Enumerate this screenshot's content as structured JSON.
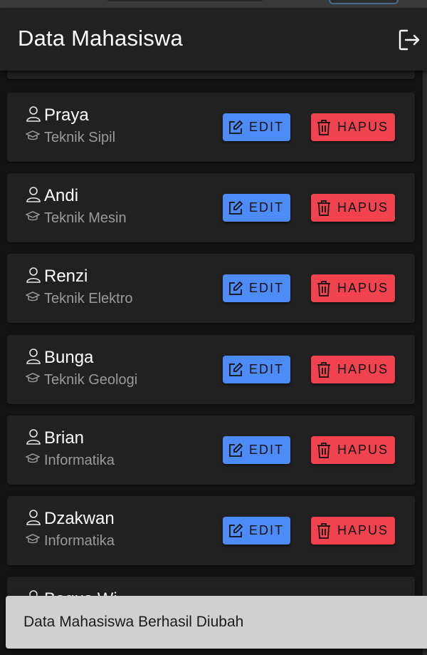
{
  "appbar": {
    "title": "Data Mahasiswa",
    "logout_icon": "logout-icon"
  },
  "actions": {
    "edit_label": "EDIT",
    "delete_label": "HAPUS"
  },
  "students": [
    {
      "name": "Praya",
      "major": "Teknik Sipil"
    },
    {
      "name": "Andi",
      "major": "Teknik Mesin"
    },
    {
      "name": "Renzi",
      "major": "Teknik Elektro"
    },
    {
      "name": "Bunga",
      "major": "Teknik Geologi"
    },
    {
      "name": "Brian",
      "major": "Informatika"
    },
    {
      "name": "Dzakwan",
      "major": "Informatika"
    },
    {
      "name": "Bagus Wi",
      "major": ""
    }
  ],
  "snackbar": {
    "message": "Data Mahasiswa Berhasil Diubah"
  },
  "colors": {
    "background": "#141414",
    "card": "#212121",
    "edit_button": "#4d8bf6",
    "delete_button": "#f1434f",
    "snackbar": "#d0d0d0"
  }
}
